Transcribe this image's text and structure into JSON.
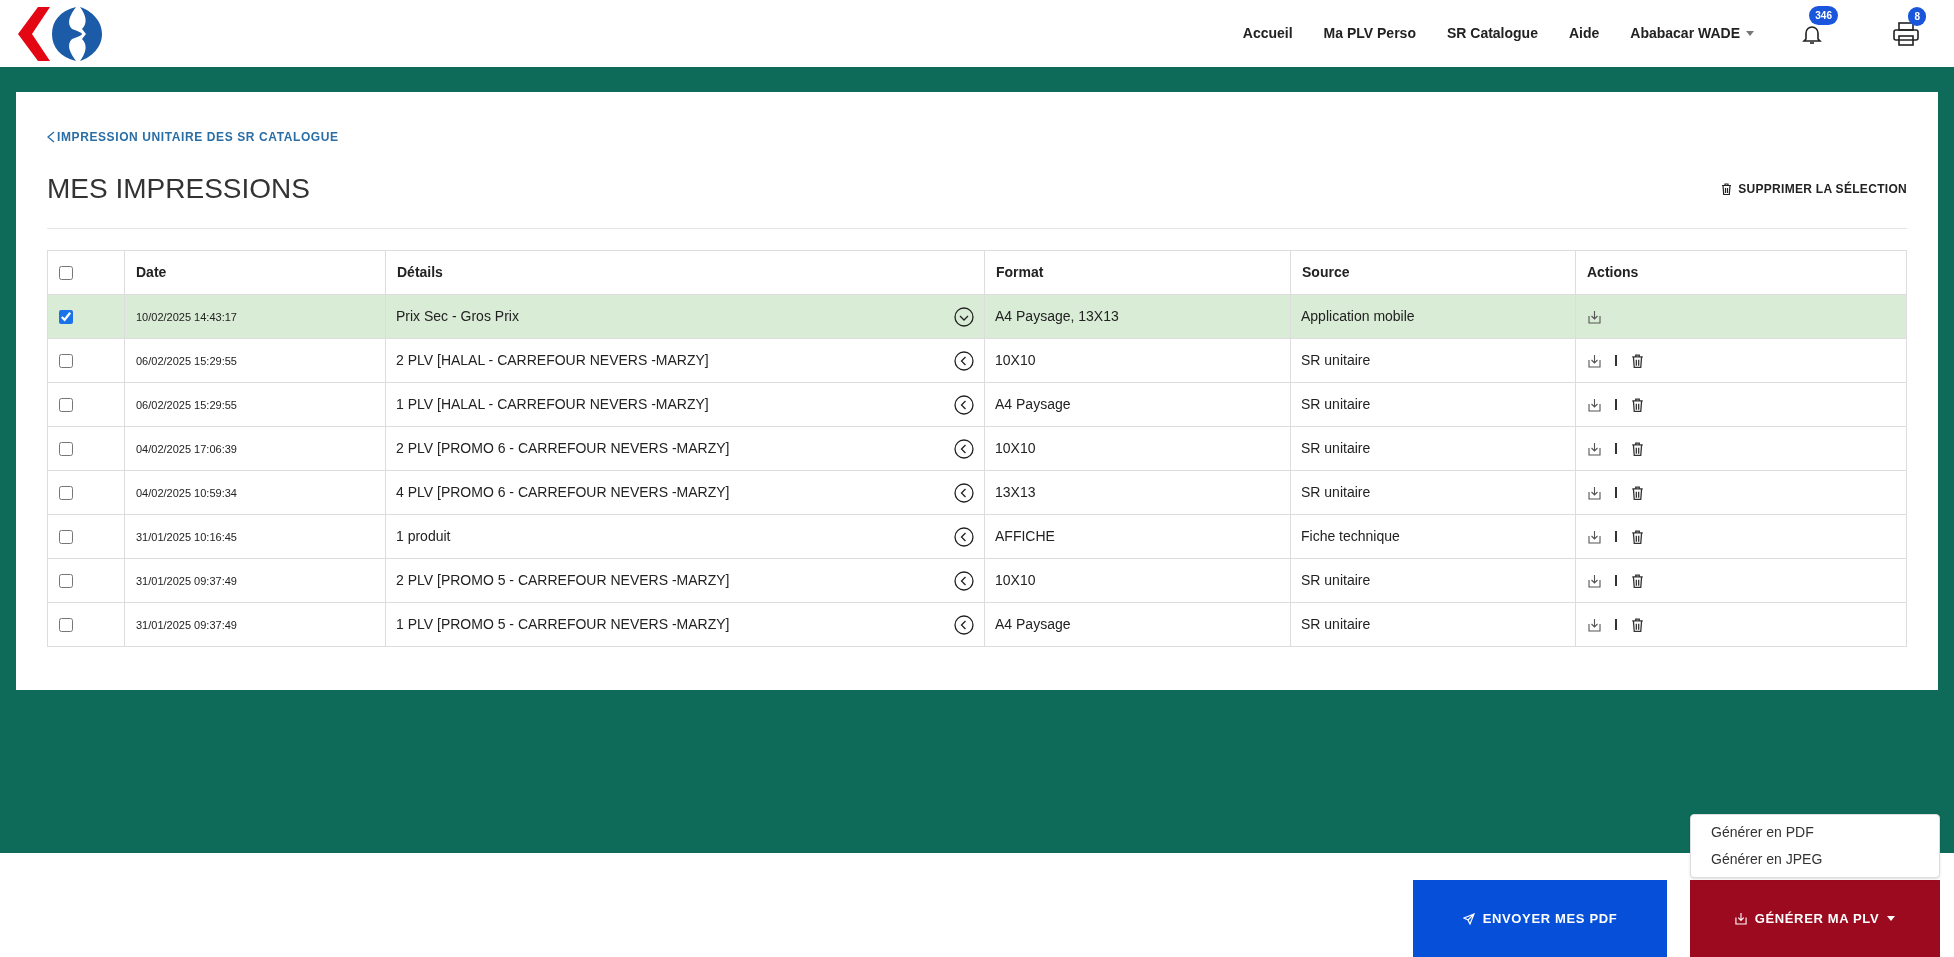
{
  "nav": {
    "items": [
      "Accueil",
      "Ma PLV Perso",
      "SR Catalogue",
      "Aide"
    ],
    "user": "Ababacar WADE",
    "notifications_badge": "346",
    "print_badge": "8"
  },
  "back_link": "IMPRESSION UNITAIRE DES SR CATALOGUE",
  "title": "MES IMPRESSIONS",
  "delete_selection": "SUPPRIMER LA SÉLECTION",
  "table": {
    "all_checked": false,
    "columns": [
      "Date",
      "Détails",
      "Format",
      "Source",
      "Actions"
    ],
    "rows": [
      {
        "date": "10/02/2025 14:43:17",
        "details": "Prix Sec - Gros Prix",
        "format": "A4 Paysage, 13X13",
        "source": "Application mobile",
        "selected": true,
        "expanded": true,
        "deletable": false
      },
      {
        "date": "06/02/2025 15:29:55",
        "details": "2 PLV [HALAL - CARREFOUR NEVERS -MARZY]",
        "format": "10X10",
        "source": "SR unitaire",
        "selected": false,
        "expanded": false,
        "deletable": true
      },
      {
        "date": "06/02/2025 15:29:55",
        "details": "1 PLV [HALAL - CARREFOUR NEVERS -MARZY]",
        "format": "A4 Paysage",
        "source": "SR unitaire",
        "selected": false,
        "expanded": false,
        "deletable": true
      },
      {
        "date": "04/02/2025 17:06:39",
        "details": "2 PLV [PROMO 6 - CARREFOUR NEVERS -MARZY]",
        "format": "10X10",
        "source": "SR unitaire",
        "selected": false,
        "expanded": false,
        "deletable": true
      },
      {
        "date": "04/02/2025 10:59:34",
        "details": "4 PLV [PROMO 6 - CARREFOUR NEVERS -MARZY]",
        "format": "13X13",
        "source": "SR unitaire",
        "selected": false,
        "expanded": false,
        "deletable": true
      },
      {
        "date": "31/01/2025 10:16:45",
        "details": "1 produit",
        "format": "AFFICHE",
        "source": "Fiche technique",
        "selected": false,
        "expanded": false,
        "deletable": true
      },
      {
        "date": "31/01/2025 09:37:49",
        "details": "2 PLV [PROMO 5 - CARREFOUR NEVERS -MARZY]",
        "format": "10X10",
        "source": "SR unitaire",
        "selected": false,
        "expanded": false,
        "deletable": true
      },
      {
        "date": "31/01/2025 09:37:49",
        "details": "1 PLV [PROMO 5 - CARREFOUR NEVERS -MARZY]",
        "format": "A4 Paysage",
        "source": "SR unitaire",
        "selected": false,
        "expanded": false,
        "deletable": true
      }
    ]
  },
  "dropdown": {
    "items": [
      "Générer en PDF",
      "Générer en JPEG"
    ]
  },
  "buttons": {
    "send": "ENVOYER MES PDF",
    "generate": "GÉNÉRER MA PLV"
  }
}
